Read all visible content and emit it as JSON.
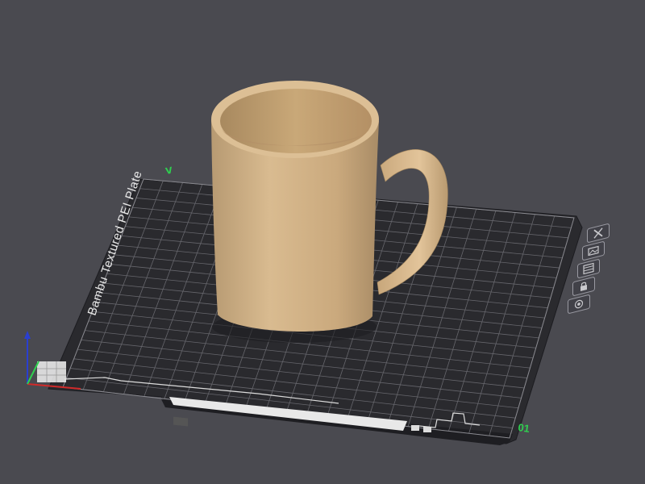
{
  "plate": {
    "name": "Bambu Textured PEI Plate",
    "number": "01",
    "axis_y_label": "V"
  },
  "plate_buttons": [
    {
      "icon": "close-icon"
    },
    {
      "icon": "image-icon"
    },
    {
      "icon": "grid-arrange-icon"
    },
    {
      "icon": "lock-icon"
    },
    {
      "icon": "settings-circle-icon"
    }
  ],
  "colors": {
    "background": "#4a4a50",
    "plate": "#2a2a2e",
    "grid": "#6a6a70",
    "model": "#d4b48a",
    "accent_green": "#2fcf4f"
  }
}
